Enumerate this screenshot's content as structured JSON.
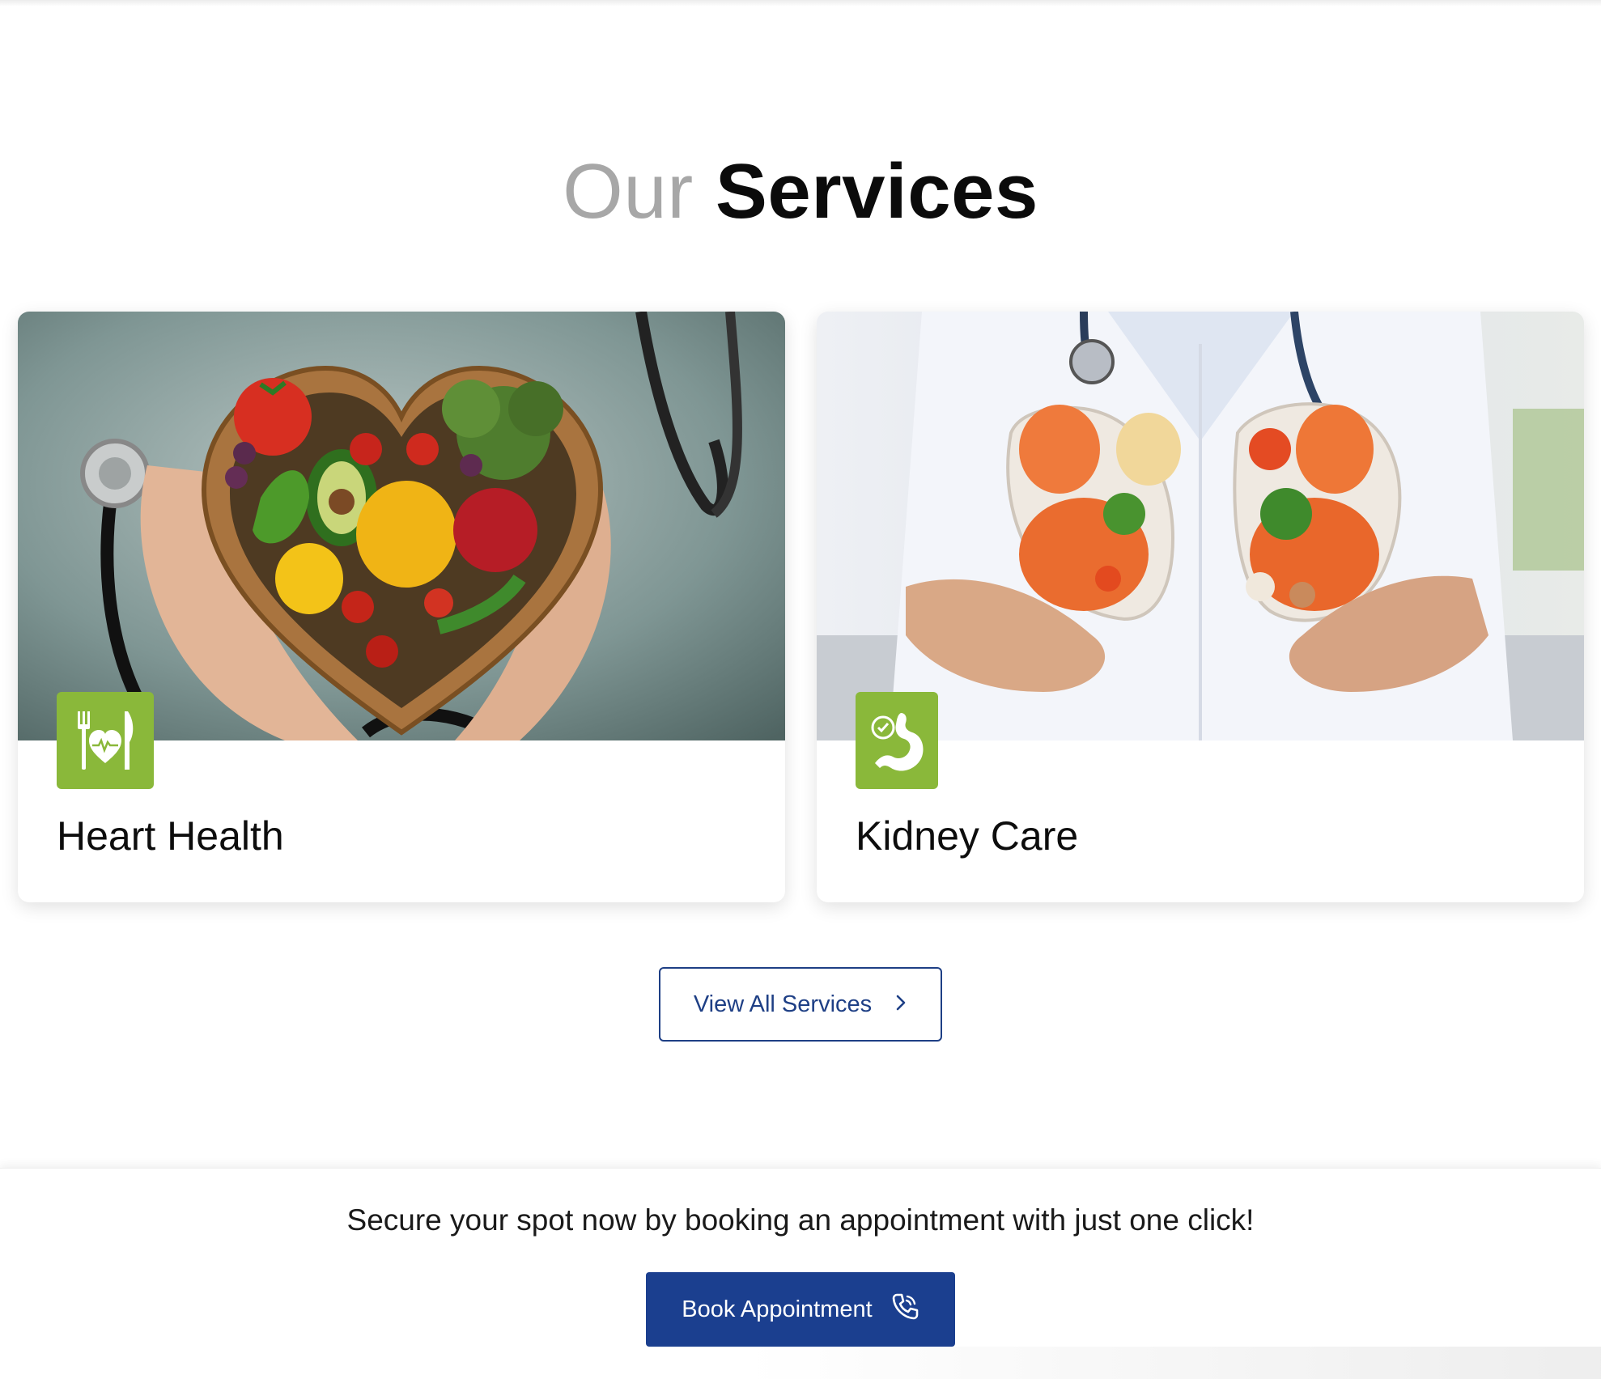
{
  "section": {
    "title_muted": "Our",
    "title_strong": "Services"
  },
  "cards": [
    {
      "title": "Heart Health",
      "icon": "diet-heart-icon",
      "image": "heart-shaped-bowl-of-vegetables-image"
    },
    {
      "title": "Kidney Care",
      "icon": "stomach-check-icon",
      "image": "doctor-holding-kidneys-image"
    }
  ],
  "view_all": {
    "label": "View All Services",
    "icon": "chevron-right-icon"
  },
  "cta": {
    "text": "Secure your spot now by booking an appointment with just one click!",
    "button_label": "Book Appointment",
    "button_icon": "phone-icon"
  },
  "colors": {
    "accent_green": "#8ab83a",
    "brand_blue": "#1b3f8f",
    "outline_blue": "#1e3f85",
    "muted_text": "#a7a7a7"
  }
}
